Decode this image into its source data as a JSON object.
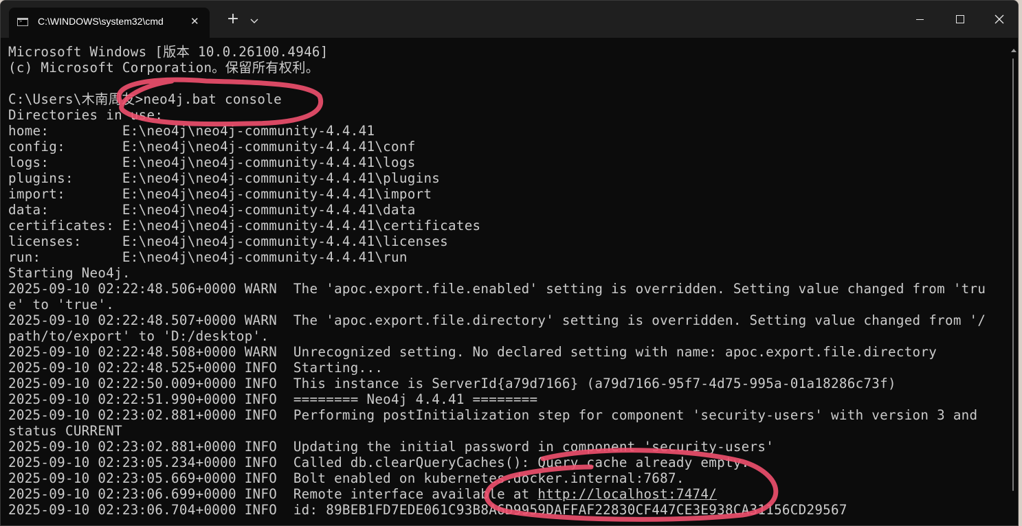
{
  "window": {
    "tab_title": "C:\\WINDOWS\\system32\\cmd",
    "tab_close_glyph": "✕",
    "new_tab_glyph": "+"
  },
  "console": {
    "lines": [
      "Microsoft Windows [版本 10.0.26100.4946]",
      "(c) Microsoft Corporation。保留所有权利。",
      "",
      "C:\\Users\\木南周友>neo4j.bat console",
      "Directories in use:",
      "home:         E:\\neo4j\\neo4j-community-4.4.41",
      "config:       E:\\neo4j\\neo4j-community-4.4.41\\conf",
      "logs:         E:\\neo4j\\neo4j-community-4.4.41\\logs",
      "plugins:      E:\\neo4j\\neo4j-community-4.4.41\\plugins",
      "import:       E:\\neo4j\\neo4j-community-4.4.41\\import",
      "data:         E:\\neo4j\\neo4j-community-4.4.41\\data",
      "certificates: E:\\neo4j\\neo4j-community-4.4.41\\certificates",
      "licenses:     E:\\neo4j\\neo4j-community-4.4.41\\licenses",
      "run:          E:\\neo4j\\neo4j-community-4.4.41\\run",
      "Starting Neo4j.",
      "2025-09-10 02:22:48.506+0000 WARN  The 'apoc.export.file.enabled' setting is overridden. Setting value changed from 'tru",
      "e' to 'true'.",
      "2025-09-10 02:22:48.507+0000 WARN  The 'apoc.export.file.directory' setting is overridden. Setting value changed from '/",
      "path/to/export' to 'D:/desktop'.",
      "2025-09-10 02:22:48.508+0000 WARN  Unrecognized setting. No declared setting with name: apoc.export.file.directory",
      "2025-09-10 02:22:48.525+0000 INFO  Starting...",
      "2025-09-10 02:22:50.009+0000 INFO  This instance is ServerId{a79d7166} (a79d7166-95f7-4d75-995a-01a18286c73f)",
      "2025-09-10 02:22:51.990+0000 INFO  ======== Neo4j 4.4.41 ========",
      "2025-09-10 02:23:02.881+0000 INFO  Performing postInitialization step for component 'security-users' with version 3 and",
      "status CURRENT",
      "2025-09-10 02:23:02.881+0000 INFO  Updating the initial password in component 'security-users'",
      "2025-09-10 02:23:05.234+0000 INFO  Called db.clearQueryCaches(): Query cache already empty.",
      "2025-09-10 02:23:05.669+0000 INFO  Bolt enabled on kubernetes.docker.internal:7687.",
      "2025-09-10 02:23:06.704+0000 INFO  id: 89BEB1FD7EDE061C93B8A6D9959DAFFAF22830CF447CE3E938CA31156CD29567"
    ],
    "remote_line_prefix": "2025-09-10 02:23:06.699+0000 INFO  Remote interface available at ",
    "remote_url": "http://localhost:7474/"
  },
  "colors": {
    "console_bg": "#0c0c0c",
    "console_text": "#cccccc",
    "titlebar_bg": "#1f1f1f",
    "annotation_stroke": "#f0506e"
  }
}
